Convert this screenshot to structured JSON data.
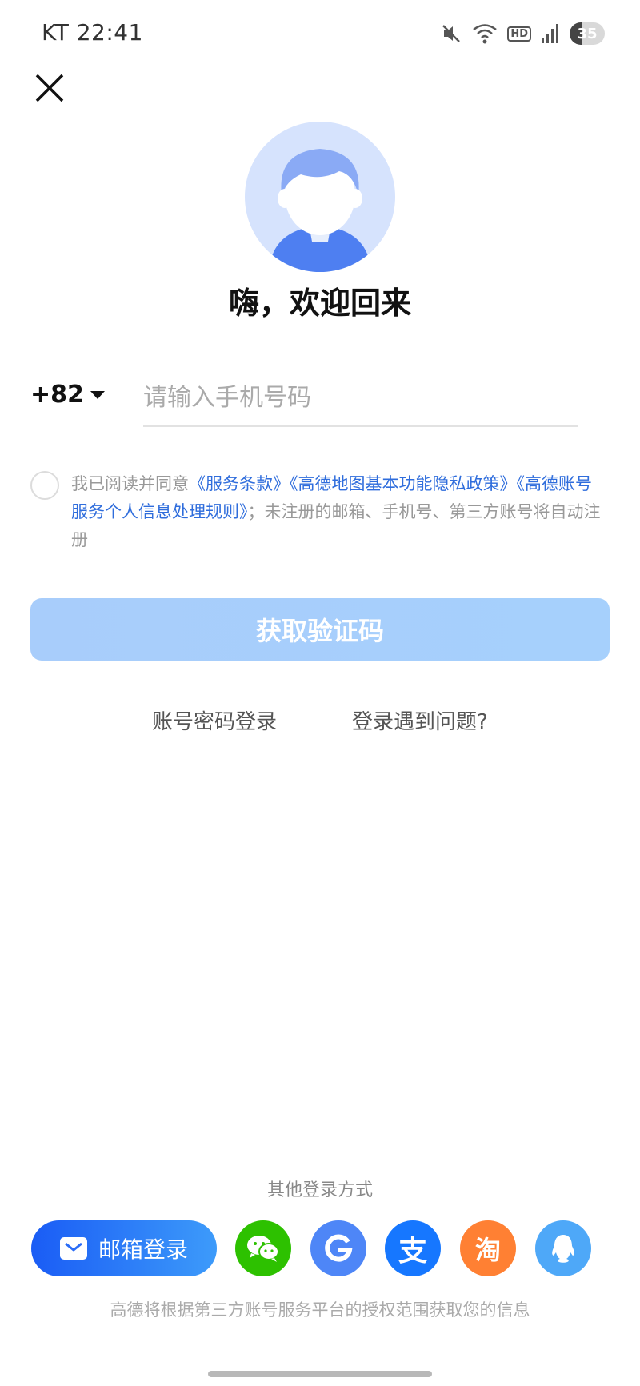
{
  "status_bar": {
    "carrier_time": "KT 22:41",
    "battery": "35",
    "hd_label": "HD",
    "icons": [
      "mute-icon",
      "wifi-icon",
      "hd-icon",
      "signal-icon",
      "battery-icon"
    ]
  },
  "header": {
    "close_icon": "close-icon"
  },
  "welcome": {
    "title": "嗨，欢迎回来"
  },
  "phone": {
    "country_code": "+82",
    "placeholder": "请输入手机号码",
    "value": ""
  },
  "agreement": {
    "prefix": "我已阅读并同意",
    "terms": "《服务条款》",
    "privacy": "《高德地图基本功能隐私政策》",
    "rules": "《高德账号服务个人信息处理规则》",
    "suffix": "；未注册的邮箱、手机号、第三方账号将自动注册",
    "checked": false
  },
  "get_code_button": "获取验证码",
  "links": {
    "password_login": "账号密码登录",
    "login_problem": "登录遇到问题?"
  },
  "other_login": {
    "title": "其他登录方式",
    "email_label": "邮箱登录",
    "providers": [
      {
        "name": "wechat",
        "color": "#2dc100"
      },
      {
        "name": "google",
        "color": "#4e86f7"
      },
      {
        "name": "alipay",
        "color": "#1677ff"
      },
      {
        "name": "taobao",
        "color": "#ff8033"
      },
      {
        "name": "qq",
        "color": "#4ea8f8"
      }
    ],
    "taobao_glyph": "淘",
    "alipay_glyph": "支",
    "note": "高德将根据第三方账号服务平台的授权范围获取您的信息"
  }
}
